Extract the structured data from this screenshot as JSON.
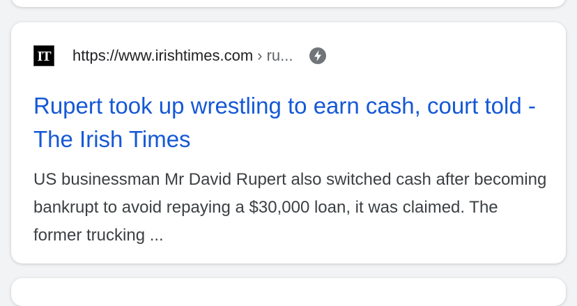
{
  "result": {
    "favicon_text": "IT",
    "url": "https://www.irishtimes.com",
    "breadcrumb": "› ru...",
    "amp_icon": "lightning-bolt-icon",
    "title": "Rupert took up wrestling to earn cash, court told - The Irish Times",
    "snippet": "US businessman Mr David Rupert also switched cash after becoming bankrupt to avoid repaying a $30,000 loan, it was claimed. The former trucking ..."
  },
  "colors": {
    "link": "#1558d6",
    "url_text": "#202124",
    "snippet_text": "#3c4043",
    "page_bg": "#f1f3f4",
    "card_bg": "#ffffff"
  }
}
